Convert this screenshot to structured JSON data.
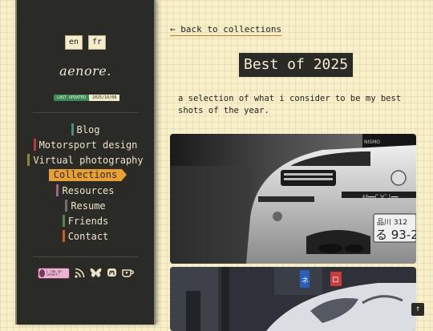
{
  "sidebar": {
    "languages": [
      "en",
      "fr"
    ],
    "logo": "aenore.",
    "last_updated_label": "LAST UPDATED",
    "last_updated_date": "2025/10/08",
    "nav": [
      {
        "label": "Blog",
        "color": "#4a8a8a",
        "active": false
      },
      {
        "label": "Motorsport design",
        "color": "#b83a3a",
        "active": false
      },
      {
        "label": "Virtual photography",
        "color": "#8a8a30",
        "active": false
      },
      {
        "label": "Collections",
        "color": "#e8a030",
        "active": true
      },
      {
        "label": "Resources",
        "color": "#a06090",
        "active": false
      },
      {
        "label": "Resume",
        "color": "#707070",
        "active": false
      },
      {
        "label": "Friends",
        "color": "#4a8a4a",
        "active": false
      },
      {
        "label": "Contact",
        "color": "#c86020",
        "active": false
      }
    ],
    "support_badge": "i rap on cohost!",
    "social_icons": [
      "rss-icon",
      "bluesky-icon",
      "mastodon-icon",
      "kofi-icon"
    ]
  },
  "main": {
    "back_link": "← back to collections",
    "title": "Best of 2025",
    "description": "a selection of what i consider to be my best shots of the year."
  },
  "photos": [
    {
      "plate_top": "品川 312",
      "plate_main": "る 93-2",
      "badge": "NISMO",
      "caption_mark": "ｷﾀ━━(ﾟ∀ﾟ)━━"
    },
    {
      "sign_1": "ネ",
      "sign_2": "ロ"
    }
  ],
  "scroll_top_label": "↑",
  "colors": {
    "accent": "#e8a030",
    "sidebar_bg": "#2a2a26",
    "page_bg": "#f8efc8"
  }
}
